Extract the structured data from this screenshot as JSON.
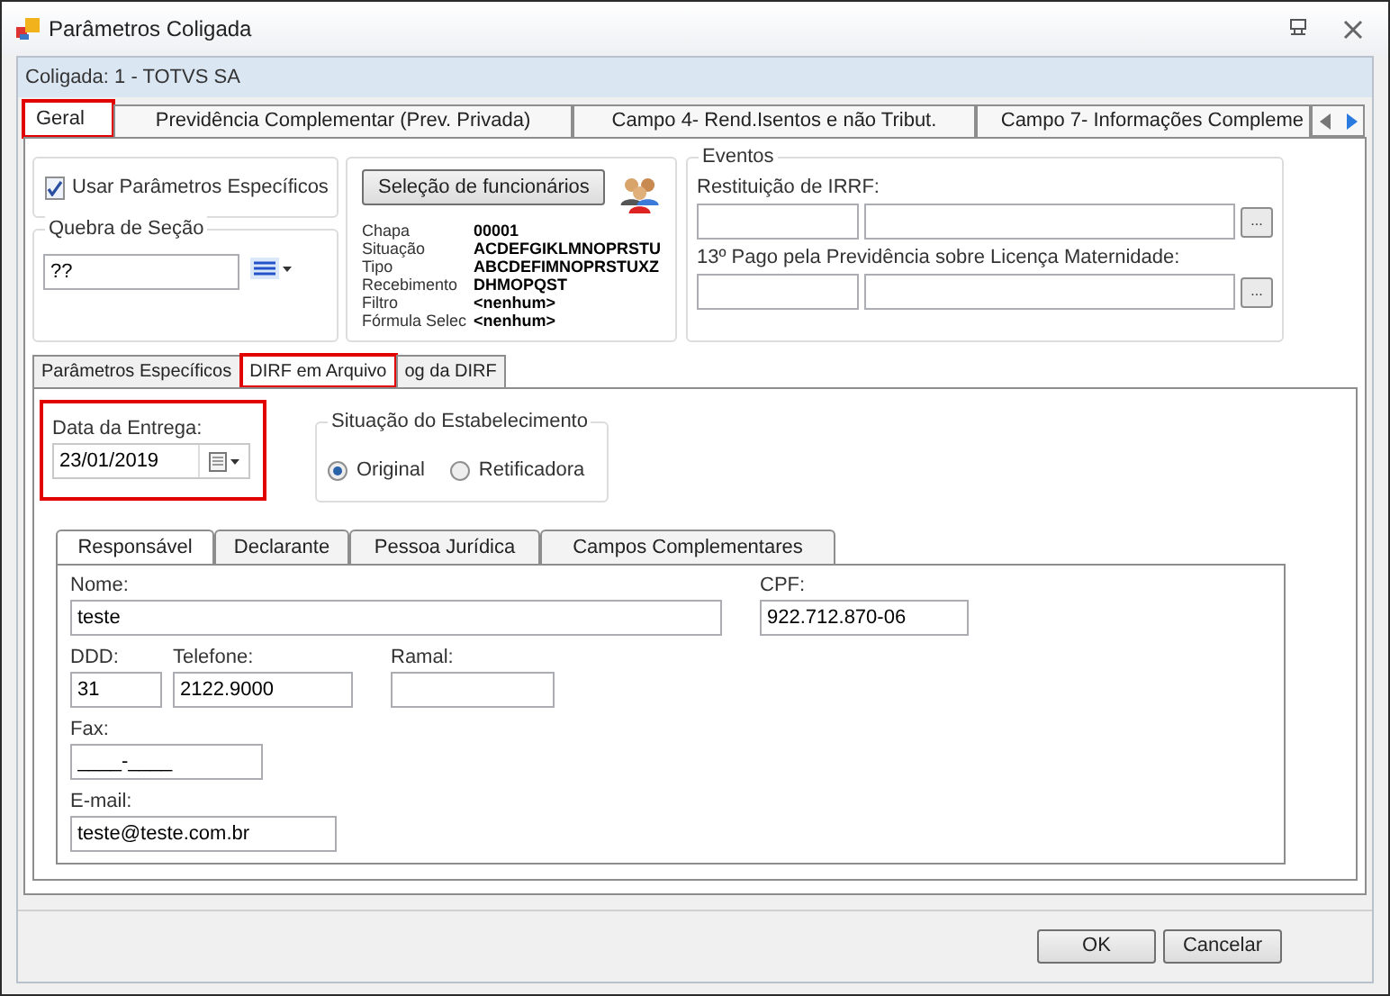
{
  "window": {
    "title": "Parâmetros Coligada"
  },
  "header": "Coligada: 1 - TOTVS SA",
  "tabs": [
    {
      "label": "Geral",
      "selected": true,
      "highlighted": true
    },
    {
      "label": "Previdência Complementar (Prev. Privada)",
      "selected": false,
      "highlighted": false
    },
    {
      "label": "Campo 4- Rend.Isentos e não Tribut.",
      "selected": false,
      "highlighted": false
    },
    {
      "label": "Campo 7- Informações Compleme",
      "selected": false,
      "highlighted": false
    }
  ],
  "use_specific": {
    "label": "Usar Parâmetros Específicos",
    "checked": true
  },
  "section_break": {
    "legend": "Quebra de Seção",
    "value": "??"
  },
  "employee_selection": {
    "button": "Seleção de funcionários",
    "rows": [
      {
        "label": "Chapa",
        "value": "00001"
      },
      {
        "label": "Situação",
        "value": "ACDEFGIKLMNOPRSTU"
      },
      {
        "label": "Tipo",
        "value": "ABCDEFIMNOPRSTUXZ"
      },
      {
        "label": "Recebimento",
        "value": "DHMOPQST"
      },
      {
        "label": "Filtro",
        "value": "<nenhum>"
      },
      {
        "label": "Fórmula Selec",
        "value": "<nenhum>"
      }
    ]
  },
  "events": {
    "legend": "Eventos",
    "fields": [
      {
        "label": "Restituição de IRRF:",
        "button": "..."
      },
      {
        "label": "13º Pago pela Previdência sobre Licença Maternidade:",
        "button": "..."
      }
    ]
  },
  "subtabs": [
    {
      "label": "Parâmetros Específicos",
      "selected": false,
      "highlighted": false
    },
    {
      "label": "DIRF em Arquivo",
      "selected": true,
      "highlighted": true
    },
    {
      "label": "og da DIRF",
      "selected": false,
      "highlighted": false
    }
  ],
  "delivery_date": {
    "label": "Data da Entrega:",
    "value": "23/01/2019",
    "highlighted": true
  },
  "establishment": {
    "legend": "Situação do Estabelecimento",
    "options": [
      {
        "label": "Original",
        "selected": true
      },
      {
        "label": "Retificadora",
        "selected": false
      }
    ]
  },
  "inner_tabs": [
    {
      "label": "Responsável",
      "selected": true
    },
    {
      "label": "Declarante",
      "selected": false
    },
    {
      "label": "Pessoa Jurídica",
      "selected": false
    },
    {
      "label": "Campos Complementares",
      "selected": false
    }
  ],
  "fields": {
    "name": {
      "label": "Nome:",
      "value": "teste"
    },
    "cpf": {
      "label": "CPF:",
      "value": "922.712.870-06"
    },
    "ddd": {
      "label": "DDD:",
      "value": "31"
    },
    "phone": {
      "label": "Telefone:",
      "value": "2122.9000"
    },
    "extension": {
      "label": "Ramal:"
    },
    "fax": {
      "label": "Fax:",
      "value": "____-____"
    },
    "email": {
      "label": "E-mail:",
      "value": "teste@teste.com.br"
    }
  },
  "buttons": [
    "OK",
    "Cancelar"
  ]
}
